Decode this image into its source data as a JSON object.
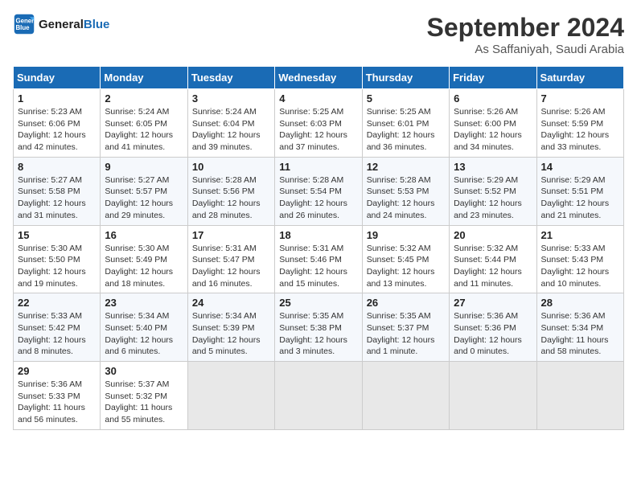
{
  "header": {
    "logo_line1": "General",
    "logo_line2": "Blue",
    "month": "September 2024",
    "location": "As Saffaniyah, Saudi Arabia"
  },
  "weekdays": [
    "Sunday",
    "Monday",
    "Tuesday",
    "Wednesday",
    "Thursday",
    "Friday",
    "Saturday"
  ],
  "weeks": [
    [
      {
        "day": "1",
        "info": "Sunrise: 5:23 AM\nSunset: 6:06 PM\nDaylight: 12 hours\nand 42 minutes."
      },
      {
        "day": "2",
        "info": "Sunrise: 5:24 AM\nSunset: 6:05 PM\nDaylight: 12 hours\nand 41 minutes."
      },
      {
        "day": "3",
        "info": "Sunrise: 5:24 AM\nSunset: 6:04 PM\nDaylight: 12 hours\nand 39 minutes."
      },
      {
        "day": "4",
        "info": "Sunrise: 5:25 AM\nSunset: 6:03 PM\nDaylight: 12 hours\nand 37 minutes."
      },
      {
        "day": "5",
        "info": "Sunrise: 5:25 AM\nSunset: 6:01 PM\nDaylight: 12 hours\nand 36 minutes."
      },
      {
        "day": "6",
        "info": "Sunrise: 5:26 AM\nSunset: 6:00 PM\nDaylight: 12 hours\nand 34 minutes."
      },
      {
        "day": "7",
        "info": "Sunrise: 5:26 AM\nSunset: 5:59 PM\nDaylight: 12 hours\nand 33 minutes."
      }
    ],
    [
      {
        "day": "8",
        "info": "Sunrise: 5:27 AM\nSunset: 5:58 PM\nDaylight: 12 hours\nand 31 minutes."
      },
      {
        "day": "9",
        "info": "Sunrise: 5:27 AM\nSunset: 5:57 PM\nDaylight: 12 hours\nand 29 minutes."
      },
      {
        "day": "10",
        "info": "Sunrise: 5:28 AM\nSunset: 5:56 PM\nDaylight: 12 hours\nand 28 minutes."
      },
      {
        "day": "11",
        "info": "Sunrise: 5:28 AM\nSunset: 5:54 PM\nDaylight: 12 hours\nand 26 minutes."
      },
      {
        "day": "12",
        "info": "Sunrise: 5:28 AM\nSunset: 5:53 PM\nDaylight: 12 hours\nand 24 minutes."
      },
      {
        "day": "13",
        "info": "Sunrise: 5:29 AM\nSunset: 5:52 PM\nDaylight: 12 hours\nand 23 minutes."
      },
      {
        "day": "14",
        "info": "Sunrise: 5:29 AM\nSunset: 5:51 PM\nDaylight: 12 hours\nand 21 minutes."
      }
    ],
    [
      {
        "day": "15",
        "info": "Sunrise: 5:30 AM\nSunset: 5:50 PM\nDaylight: 12 hours\nand 19 minutes."
      },
      {
        "day": "16",
        "info": "Sunrise: 5:30 AM\nSunset: 5:49 PM\nDaylight: 12 hours\nand 18 minutes."
      },
      {
        "day": "17",
        "info": "Sunrise: 5:31 AM\nSunset: 5:47 PM\nDaylight: 12 hours\nand 16 minutes."
      },
      {
        "day": "18",
        "info": "Sunrise: 5:31 AM\nSunset: 5:46 PM\nDaylight: 12 hours\nand 15 minutes."
      },
      {
        "day": "19",
        "info": "Sunrise: 5:32 AM\nSunset: 5:45 PM\nDaylight: 12 hours\nand 13 minutes."
      },
      {
        "day": "20",
        "info": "Sunrise: 5:32 AM\nSunset: 5:44 PM\nDaylight: 12 hours\nand 11 minutes."
      },
      {
        "day": "21",
        "info": "Sunrise: 5:33 AM\nSunset: 5:43 PM\nDaylight: 12 hours\nand 10 minutes."
      }
    ],
    [
      {
        "day": "22",
        "info": "Sunrise: 5:33 AM\nSunset: 5:42 PM\nDaylight: 12 hours\nand 8 minutes."
      },
      {
        "day": "23",
        "info": "Sunrise: 5:34 AM\nSunset: 5:40 PM\nDaylight: 12 hours\nand 6 minutes."
      },
      {
        "day": "24",
        "info": "Sunrise: 5:34 AM\nSunset: 5:39 PM\nDaylight: 12 hours\nand 5 minutes."
      },
      {
        "day": "25",
        "info": "Sunrise: 5:35 AM\nSunset: 5:38 PM\nDaylight: 12 hours\nand 3 minutes."
      },
      {
        "day": "26",
        "info": "Sunrise: 5:35 AM\nSunset: 5:37 PM\nDaylight: 12 hours\nand 1 minute."
      },
      {
        "day": "27",
        "info": "Sunrise: 5:36 AM\nSunset: 5:36 PM\nDaylight: 12 hours\nand 0 minutes."
      },
      {
        "day": "28",
        "info": "Sunrise: 5:36 AM\nSunset: 5:34 PM\nDaylight: 11 hours\nand 58 minutes."
      }
    ],
    [
      {
        "day": "29",
        "info": "Sunrise: 5:36 AM\nSunset: 5:33 PM\nDaylight: 11 hours\nand 56 minutes."
      },
      {
        "day": "30",
        "info": "Sunrise: 5:37 AM\nSunset: 5:32 PM\nDaylight: 11 hours\nand 55 minutes."
      },
      {
        "day": "",
        "info": ""
      },
      {
        "day": "",
        "info": ""
      },
      {
        "day": "",
        "info": ""
      },
      {
        "day": "",
        "info": ""
      },
      {
        "day": "",
        "info": ""
      }
    ]
  ]
}
